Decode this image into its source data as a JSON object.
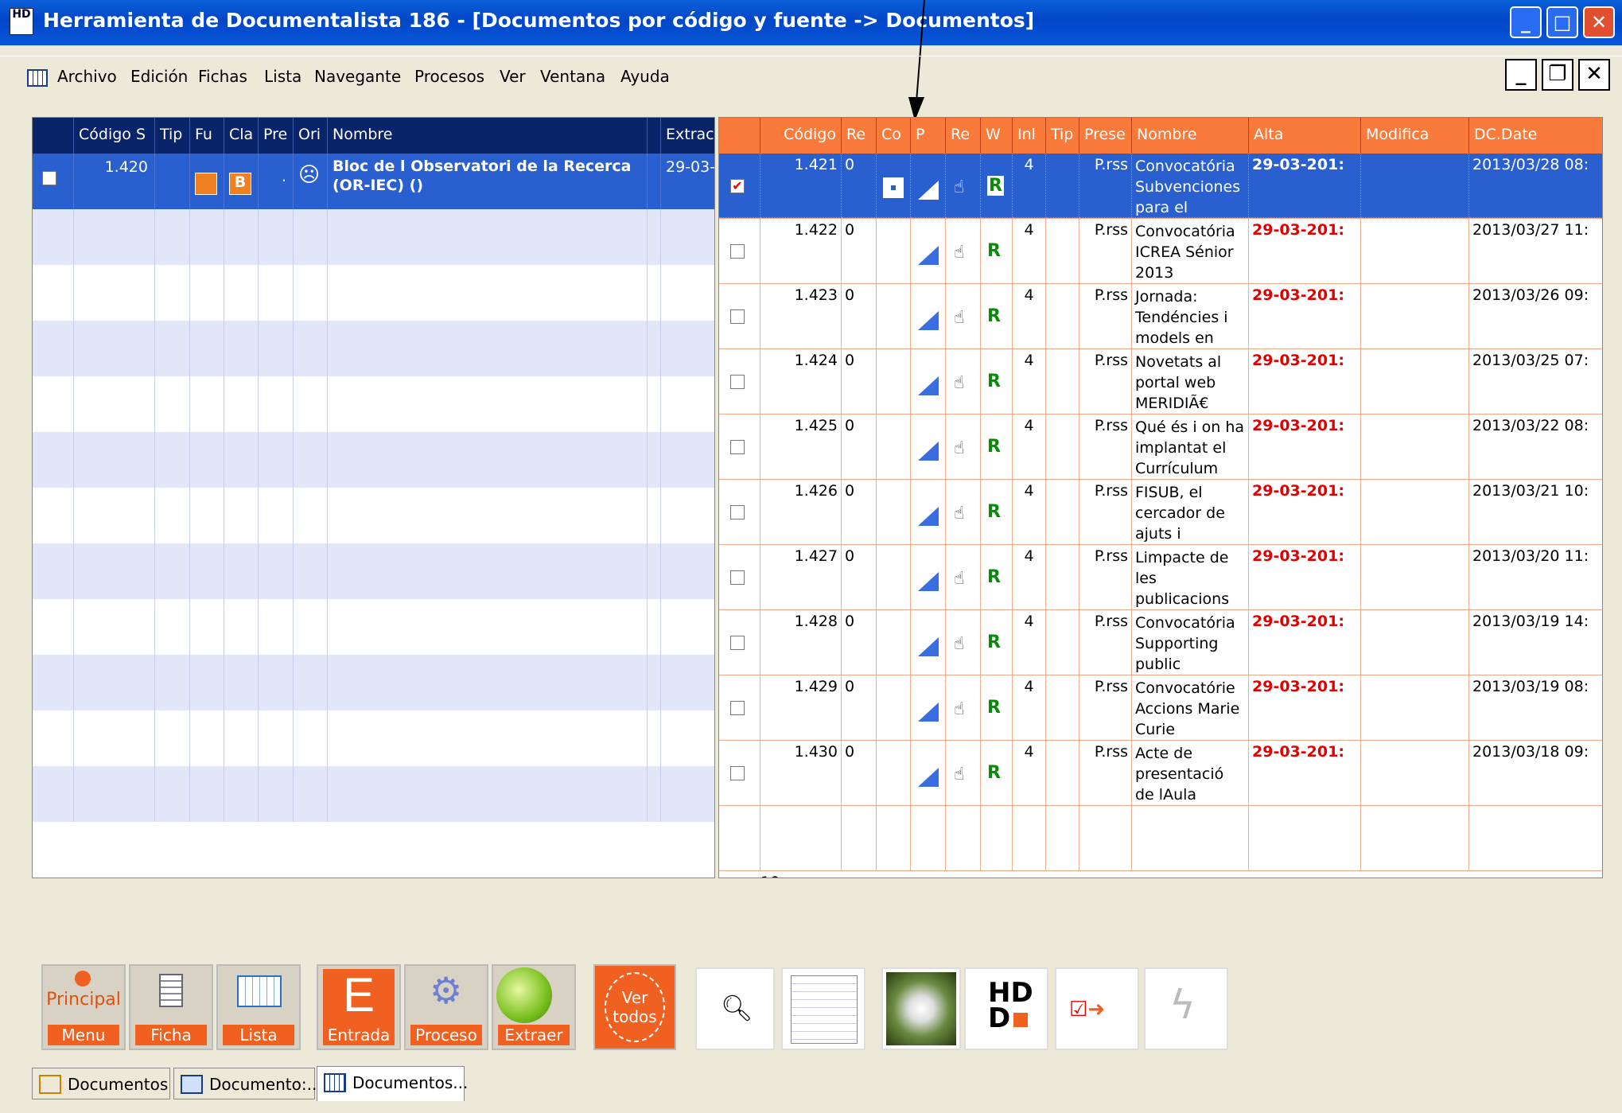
{
  "window": {
    "title": "Herramienta de Documentalista 186 - [Documentos por código y fuente -> Documentos]",
    "app_icon": "HD"
  },
  "menu": [
    "Archivo",
    "Edición",
    "Fichas",
    "Lista",
    "Navegante",
    "Procesos",
    "Ver",
    "Ventana",
    "Ayuda"
  ],
  "left_grid": {
    "columns": [
      "Código S",
      "Tip",
      "Fu",
      "Cla",
      "Pre",
      "Ori",
      "Nombre",
      "Extrac"
    ],
    "rows": [
      {
        "code": "1.420",
        "pre": ".",
        "name": "Bloc de l Observatori de la Recerca (OR-IEC) ()",
        "extract": "29-03-"
      }
    ],
    "footer_count": "1"
  },
  "right_grid": {
    "columns": [
      "Código",
      "Re",
      "Co",
      "P",
      "Re",
      "W",
      "Inl",
      "Tip",
      "Prese",
      "Nombre",
      "Alta",
      "Modifica",
      "DC.Date"
    ],
    "rows": [
      {
        "code": "1.421",
        "re": "0",
        "inl": "4",
        "pres": "P.rss",
        "name": "Convocatória Subvenciones para el",
        "alta": "29-03-201:",
        "dcdate": "2013/03/28 08:",
        "w": "R",
        "checked": true
      },
      {
        "code": "1.422",
        "re": "0",
        "inl": "4",
        "pres": "P.rss",
        "name": "Convocatória ICREA Sénior 2013",
        "alta": "29-03-201:",
        "dcdate": "2013/03/27 11:",
        "w": "R",
        "checked": false
      },
      {
        "code": "1.423",
        "re": "0",
        "inl": "4",
        "pres": "P.rss",
        "name": "Jornada: Tendéncies i models en",
        "alta": "29-03-201:",
        "dcdate": "2013/03/26 09:",
        "w": "R",
        "checked": false
      },
      {
        "code": "1.424",
        "re": "0",
        "inl": "4",
        "pres": "P.rss",
        "name": "Novetats al portal web MERIDIÃ€",
        "alta": "29-03-201:",
        "dcdate": "2013/03/25 07:",
        "w": "R",
        "checked": false
      },
      {
        "code": "1.425",
        "re": "0",
        "inl": "4",
        "pres": "P.rss",
        "name": "Qué és i on ha implantat el Currículum",
        "alta": "29-03-201:",
        "dcdate": "2013/03/22 08:",
        "w": "R",
        "checked": false
      },
      {
        "code": "1.426",
        "re": "0",
        "inl": "4",
        "pres": "P.rss",
        "name": "FISUB, el cercador de ajuts i",
        "alta": "29-03-201:",
        "dcdate": "2013/03/21 10:",
        "w": "R",
        "checked": false
      },
      {
        "code": "1.427",
        "re": "0",
        "inl": "4",
        "pres": "P.rss",
        "name": "Limpacte de les publicacions",
        "alta": "29-03-201:",
        "dcdate": "2013/03/20 11:",
        "w": "R",
        "checked": false
      },
      {
        "code": "1.428",
        "re": "0",
        "inl": "4",
        "pres": "P.rss",
        "name": "Convocatória Supporting public",
        "alta": "29-03-201:",
        "dcdate": "2013/03/19 14:",
        "w": "R",
        "checked": false
      },
      {
        "code": "1.429",
        "re": "0",
        "inl": "4",
        "pres": "P.rss",
        "name": "Convocatórie Accions Marie Curie",
        "alta": "29-03-201:",
        "dcdate": "2013/03/19 08:",
        "w": "R",
        "checked": false
      },
      {
        "code": "1.430",
        "re": "0",
        "inl": "4",
        "pres": "P.rss",
        "name": "Acte de presentació de lAula",
        "alta": "29-03-201:",
        "dcdate": "2013/03/18 09:",
        "w": "R",
        "checked": false
      }
    ],
    "footer_count": "10"
  },
  "toolbar": {
    "principal_top": "Principal",
    "principal": "Menu",
    "ficha": "Ficha",
    "lista": "Lista",
    "entrada_letter": "E",
    "entrada": "Entrada",
    "proceso": "Proceso",
    "extraer": "Extraer",
    "ver_todos_1": "Ver",
    "ver_todos_2": "todos",
    "hd_top": "HD",
    "hd_bottom": "D"
  },
  "tabs": [
    "Documentos",
    "Documento:...",
    "Documentos..."
  ],
  "colors": {
    "title_blue": "#0046c8",
    "grid_header_left": "#0a246a",
    "grid_header_right": "#f97a3a",
    "accent_orange": "#f06020",
    "alta_red": "#e00000"
  }
}
